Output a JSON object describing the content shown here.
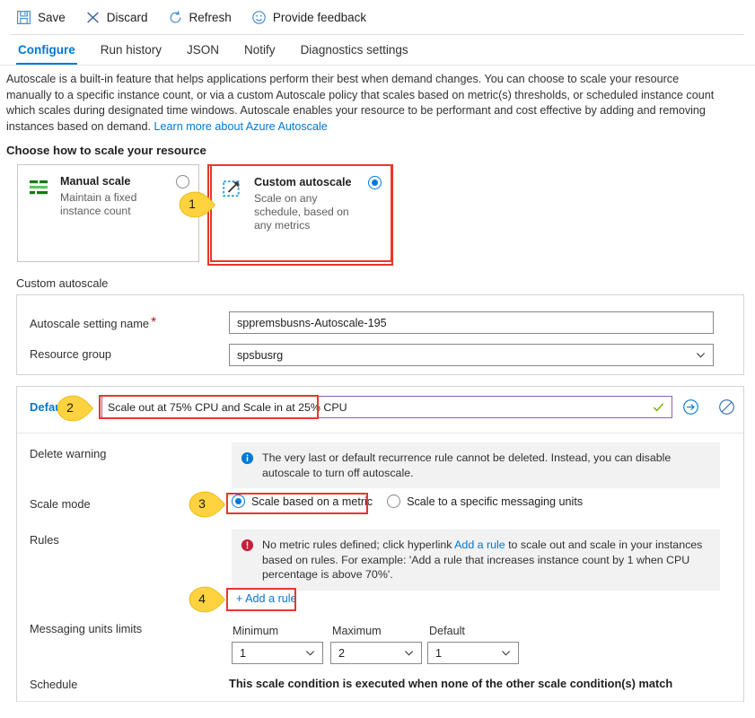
{
  "toolbar": {
    "items": [
      {
        "label": "Save",
        "icon": "save-icon"
      },
      {
        "label": "Discard",
        "icon": "close-x-icon"
      },
      {
        "label": "Refresh",
        "icon": "refresh-icon"
      },
      {
        "label": "Provide feedback",
        "icon": "smiley-face-icon"
      }
    ]
  },
  "tabs": [
    {
      "label": "Configure",
      "active": true
    },
    {
      "label": "Run history",
      "active": false
    },
    {
      "label": "JSON",
      "active": false
    },
    {
      "label": "Notify",
      "active": false
    },
    {
      "label": "Diagnostics settings",
      "active": false
    }
  ],
  "intro": {
    "text": "Autoscale is a built-in feature that helps applications perform their best when demand changes. You can choose to scale your resource manually to a specific instance count, or via a custom Autoscale policy that scales based on metric(s) thresholds, or scheduled instance count which scales during designated time windows. Autoscale enables your resource to be performant and cost effective by adding and removing instances based on demand. ",
    "link": "Learn more about Azure Autoscale"
  },
  "section_heading": "Choose how to scale your resource",
  "scale_cards": [
    {
      "title": "Manual scale",
      "subtitle": "Maintain a fixed instance count",
      "icon": "green-bars-icon",
      "selected": false
    },
    {
      "title": "Custom autoscale",
      "subtitle": "Scale on any schedule, based on any metrics",
      "icon": "dashed-box-arrow-icon",
      "selected": true
    }
  ],
  "custom_autoscale": {
    "label": "Custom autoscale",
    "setting_name": {
      "label": "Autoscale setting name",
      "required_mark": "*",
      "value": "sppremsbusns-Autoscale-195"
    },
    "resource_group": {
      "label": "Resource group",
      "value": "spsbusrg"
    }
  },
  "condition": {
    "title": "Default",
    "name_value": "Scale out at 75% CPU and Scale in at 25% CPU",
    "check_icon": "checkmark-icon",
    "move_icon": "move-arrow-icon",
    "disable_icon": "block-disable-icon",
    "delete_warning": {
      "label": "Delete warning",
      "icon": "info-icon",
      "text": "The very last or default recurrence rule cannot be deleted. Instead, you can disable autoscale to turn off autoscale."
    },
    "scale_mode": {
      "label": "Scale mode",
      "options": [
        {
          "label": "Scale based on a metric",
          "selected": true
        },
        {
          "label": "Scale to a specific messaging units",
          "selected": false
        }
      ]
    },
    "rules": {
      "label": "Rules",
      "icon": "error-icon",
      "text_before_link": "No metric rules defined; click hyperlink ",
      "link": "Add a rule",
      "text_after_link": " to scale out and scale in your instances based on rules. For example: 'Add a rule that increases instance count by 1 when CPU percentage is above 70%'."
    },
    "add_rule_button": "+ Add a rule",
    "limits": {
      "label": "Messaging units limits",
      "columns": [
        {
          "header": "Minimum",
          "value": "1"
        },
        {
          "header": "Maximum",
          "value": "2"
        },
        {
          "header": "Default",
          "value": "1"
        }
      ]
    },
    "schedule": {
      "label": "Schedule",
      "text": "This scale condition is executed when none of the other scale condition(s) match"
    }
  },
  "annotations": [
    {
      "number": "1"
    },
    {
      "number": "2"
    },
    {
      "number": "3"
    },
    {
      "number": "4"
    }
  ],
  "colors": {
    "accent": "#0078d4",
    "annotation_red": "#e8372c",
    "callout_yellow": "#ffd23f",
    "purple_border": "#8764b8",
    "error_red": "#a4262c",
    "green": "#107c10"
  }
}
